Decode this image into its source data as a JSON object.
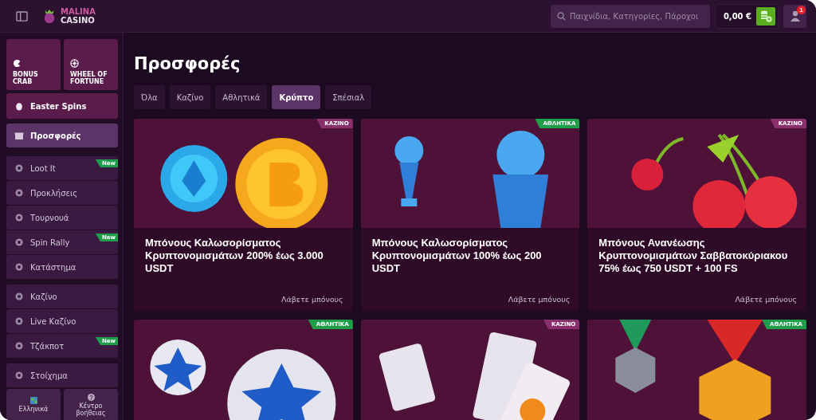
{
  "header": {
    "logo": {
      "line_1": "MALINA",
      "line_2": "CASINO"
    },
    "search": {
      "placeholder": "Παιχνίδια, Κατηγορίες, Πάροχοι"
    },
    "balance": "0,00 €",
    "notification_count": "1"
  },
  "sidebar": {
    "promo_tiles": [
      {
        "label": "BONUS CRAB"
      },
      {
        "label": "WHEEL OF FORTUNE"
      }
    ],
    "featured": {
      "label": "Easter Spins"
    },
    "active_item": {
      "label": "Προσφορές",
      "selected": true
    },
    "groups": [
      [
        {
          "label": "Loot It",
          "new": true,
          "badge": "New"
        },
        {
          "label": "Προκλήσεις",
          "new": false
        },
        {
          "label": "Τουρνουά",
          "new": false
        },
        {
          "label": "Spin Rally",
          "new": true,
          "badge": "New"
        },
        {
          "label": "Κατάστημα",
          "new": false
        }
      ],
      [
        {
          "label": "Καζίνο",
          "new": false
        },
        {
          "label": "Live Καζίνο",
          "new": false
        },
        {
          "label": "Τζάκποτ",
          "new": true,
          "badge": "New"
        }
      ],
      [
        {
          "label": "Στοίχημα",
          "new": false
        }
      ]
    ],
    "bottom_tiles": [
      {
        "label": "Ελληνικά"
      },
      {
        "label": "Κέντρο βοήθειας"
      }
    ]
  },
  "page": {
    "title": "Προσφορές",
    "tabs": [
      {
        "label": "Όλα",
        "selected": false
      },
      {
        "label": "Καζίνο",
        "selected": false
      },
      {
        "label": "Αθλητικά",
        "selected": false
      },
      {
        "label": "Κρύπτο",
        "selected": true
      },
      {
        "label": "Σπέσιαλ",
        "selected": false
      }
    ],
    "cards": [
      {
        "tag": "ΚΑΖΙΝΟ",
        "color": "#8a2f6e",
        "title": "Μπόνους Καλωσορίσματος Κρυπτονομισμάτων 200% έως 3.000 USDT",
        "action": "Λάβετε μπόνους"
      },
      {
        "tag": "ΑΘΛΗΤΙΚΑ",
        "color": "#1f9e4a",
        "title": "Μπόνους Καλωσορίσματος Κρυπτονομισμάτων 100% έως 200 USDT",
        "action": "Λάβετε μπόνους"
      },
      {
        "tag": "ΚΑΖΙΝΟ",
        "color": "#8a2f6e",
        "title": "Μπόνους Ανανέωσης Κρυπτονομισμάτων Σαββατοκύριακου 75% έως 750 USDT + 100 FS",
        "action": "Λάβετε μπόνους"
      },
      {
        "tag": "ΑΘΛΗΤΙΚΑ",
        "color": "#1f9e4a"
      },
      {
        "tag": "ΚΑΖΙΝΟ",
        "color": "#8a2f6e"
      },
      {
        "tag": "ΑΘΛΗΤΙΚΑ",
        "color": "#1f9e4a"
      }
    ]
  }
}
